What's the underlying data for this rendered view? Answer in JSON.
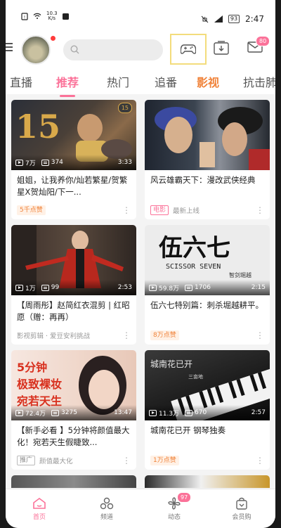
{
  "status_bar": {
    "net_speed": "10.3",
    "net_unit": "K/s",
    "battery": "93",
    "time": "2:47"
  },
  "header": {
    "mail_badge": "80"
  },
  "tabs": [
    {
      "label": "直播"
    },
    {
      "label": "推荐"
    },
    {
      "label": "热门"
    },
    {
      "label": "追番"
    },
    {
      "label": "影视"
    },
    {
      "label": "抗击肺"
    }
  ],
  "cards": [
    {
      "views": "7万",
      "danmaku": "374",
      "duration": "3:33",
      "corner": "15",
      "title": "姐姐，让我养你/灿若繁星/贺繁星X贺灿阳/下一...",
      "tag": "5千点赞",
      "source": ""
    },
    {
      "views": "",
      "danmaku": "",
      "duration": "",
      "title": "风云雄霸天下：漫改武侠经典",
      "tag": "电影",
      "source": "最新上线"
    },
    {
      "views": "1万",
      "danmaku": "99",
      "duration": "2:53",
      "title": "【周雨彤】赵简红衣混剪 | 红昭愿（赠：再再）",
      "tag": "",
      "source": "影视剪辑 · 爱豆安利挑战"
    },
    {
      "views": "59.8万",
      "danmaku": "1706",
      "duration": "2:15",
      "title": "伍六七特别篇：刺杀堀越耕平。",
      "tag": "8万点赞",
      "source": "",
      "thumb_big": "伍六七",
      "thumb_sub": "SCISSOR SEVEN",
      "thumb_small": "智剑堀越"
    },
    {
      "views": "72.4万",
      "danmaku": "3275",
      "duration": "13:47",
      "title": "【新手必看 】5分钟将颜值最大化！宛若天生假睫致...",
      "tag": "推广",
      "source": "颜值最大化",
      "thumb_lines": [
        "5分钟",
        "极致裸妆",
        "宛若天生"
      ]
    },
    {
      "views": "11.3万",
      "danmaku": "670",
      "duration": "2:57",
      "title": "城南花已开  钢琴独奏",
      "tag": "1万点赞",
      "source": "",
      "thumb_text": "城南花已开",
      "thumb_sub": "三亩地"
    }
  ],
  "bottom_nav": [
    {
      "label": "首页"
    },
    {
      "label": "频道"
    },
    {
      "label": "动态",
      "badge": "97"
    },
    {
      "label": "会员购"
    }
  ],
  "colors": {
    "accent": "#fb7299",
    "highlight": "#f0833a"
  }
}
